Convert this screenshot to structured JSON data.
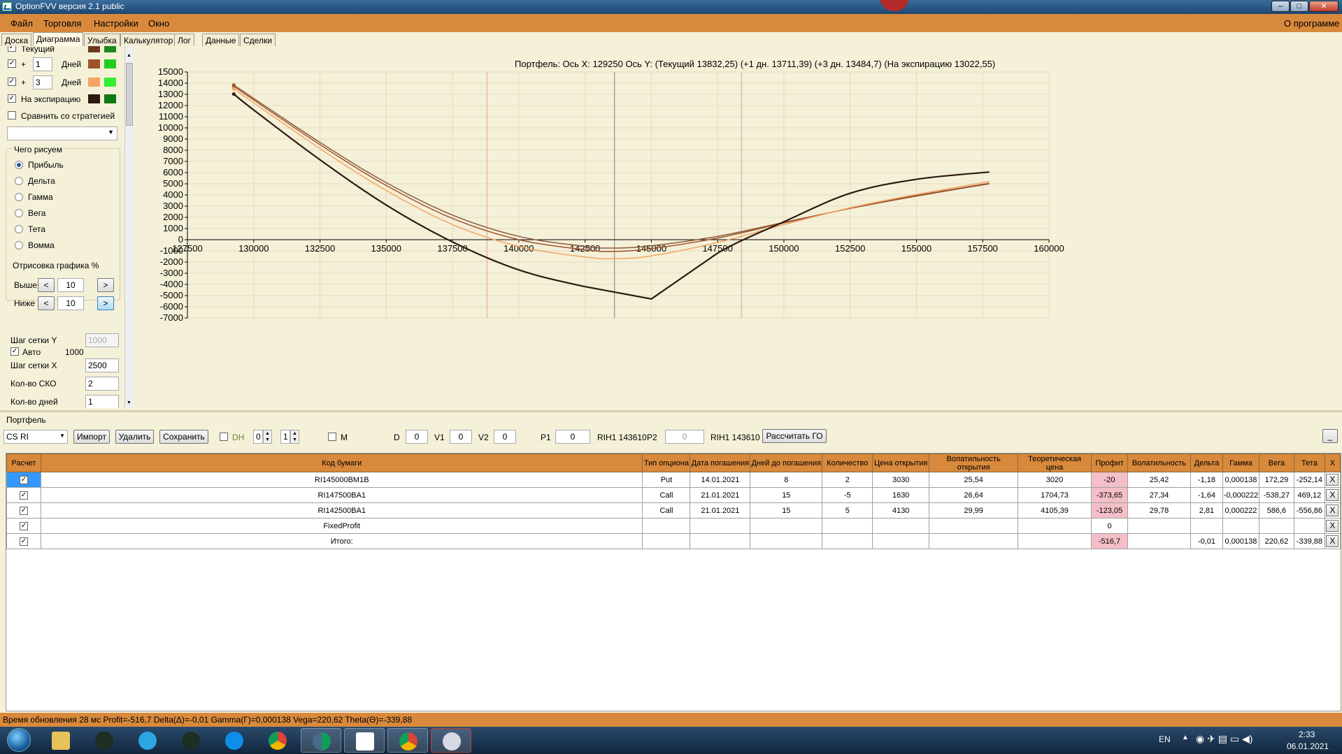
{
  "window": {
    "title": "OptionFVV версия 2.1 public"
  },
  "menu": {
    "items": [
      "Файл",
      "Торговля",
      "Настройки",
      "Окно"
    ],
    "about": "О программе"
  },
  "tabs": [
    "Доска",
    "Диаграмма",
    "Улыбка",
    "Калькулятор",
    "Лог",
    "Данные",
    "Сделки"
  ],
  "left": {
    "curves": [
      {
        "label": "Текущий",
        "plus": "",
        "days": "",
        "days_label": "",
        "color1": "#6b3a1e",
        "color2": "#1a8a1a"
      },
      {
        "label": "",
        "plus": "+",
        "days": "1",
        "days_label": "Дней",
        "color1": "#a0522d",
        "color2": "#22cc22"
      },
      {
        "label": "",
        "plus": "+",
        "days": "3",
        "days_label": "Дней",
        "color1": "#f4a460",
        "color2": "#33ee33"
      },
      {
        "label": "На экспирацию",
        "plus": "",
        "days": "",
        "days_label": "",
        "color1": "#2b1a10",
        "color2": "#0f7a0f"
      }
    ],
    "compare": "Сравнить со стратегией",
    "draw_group": "Чего рисуем",
    "draw_options": [
      "Прибыль",
      "Дельта",
      "Гамма",
      "Вега",
      "Тета",
      "Вомма"
    ],
    "render_group": "Отрисовка графика %",
    "above_label": "Выше",
    "above_value": "10",
    "below_label": "Ниже",
    "below_value": "10",
    "prev": "<",
    "next": ">",
    "grid_y_label": "Шаг сетки Y",
    "grid_y_value": "1000",
    "auto_label": "Авто",
    "auto_value": "1000",
    "grid_x_label": "Шаг сетки X",
    "grid_x_value": "2500",
    "sko_label": "Кол-во СКО",
    "sko_value": "2",
    "days_count_label": "Кол-во дней",
    "days_count_value": "1"
  },
  "chart_data": {
    "type": "line",
    "title": "Портфель: Ось X:  129250 Ось Y:   (Текущий 13832,25)  (+1 дн. 13711,39)  (+3 дн. 13484,7)  (На экспирацию 13022,55)",
    "xlim": [
      127500,
      160000
    ],
    "ylim": [
      -7000,
      15000
    ],
    "x_ticks": [
      127500,
      130000,
      132500,
      135000,
      137500,
      140000,
      142500,
      145000,
      147500,
      150000,
      152500,
      155000,
      157500,
      160000
    ],
    "y_ticks": [
      15000,
      14000,
      13000,
      12000,
      11000,
      10000,
      9000,
      8000,
      7000,
      6000,
      5000,
      4000,
      3000,
      2000,
      1000,
      0,
      -1000,
      -2000,
      -3000,
      -4000,
      -5000,
      -6000,
      -7000
    ],
    "vlines": [
      {
        "x": 143610,
        "color": "#808080"
      },
      {
        "x": 138800,
        "color": "#e8a0a0"
      },
      {
        "x": 148400,
        "color": "#e8a0a0"
      }
    ],
    "series": [
      {
        "color": "#8b5a3c",
        "x": [
          129250,
          132500,
          135000,
          137500,
          140000,
          142500,
          143610,
          145000,
          147500,
          150000,
          152500,
          155000,
          157750
        ],
        "values": [
          13832,
          8700,
          5100,
          2200,
          300,
          -600,
          -750,
          -550,
          300,
          1550,
          2800,
          3900,
          5000
        ]
      },
      {
        "color": "#a0522d",
        "x": [
          129250,
          132500,
          135000,
          137500,
          140000,
          142500,
          143610,
          145000,
          147500,
          150000,
          152500,
          155000,
          157750
        ],
        "values": [
          13711,
          8500,
          4850,
          1900,
          0,
          -900,
          -1050,
          -800,
          150,
          1500,
          2800,
          3950,
          5050
        ]
      },
      {
        "color": "#f4a460",
        "x": [
          129250,
          132500,
          135000,
          137500,
          140000,
          142500,
          143610,
          145000,
          147500,
          150000,
          152500,
          155000,
          157750
        ],
        "values": [
          13485,
          8150,
          4400,
          1350,
          -600,
          -1550,
          -1700,
          -1450,
          -250,
          1350,
          2850,
          4050,
          5200
        ]
      },
      {
        "color": "#2b1a10",
        "x": [
          129250,
          130000,
          132500,
          135000,
          137500,
          140000,
          142500,
          145000,
          147500,
          150000,
          152500,
          155000,
          157750
        ],
        "values": [
          13023,
          11600,
          7150,
          3100,
          -200,
          -2700,
          -4200,
          -5300,
          -1200,
          1600,
          4150,
          5400,
          6050
        ]
      }
    ]
  },
  "portfolio": {
    "title": "Портфель",
    "account": "CS RI",
    "import": "Импорт",
    "delete": "Удалить",
    "save": "Сохранить",
    "dh_label": "DH",
    "dh_v1": "0",
    "dh_v2": "1",
    "m_label": "M",
    "d_label": "D",
    "d_value": "0",
    "v1_label": "V1",
    "v1_value": "0",
    "v2_label": "V2",
    "v2_value": "0",
    "p1_label": "P1",
    "p1_value": "0",
    "rih1": "RIH1 143610",
    "p2_label": "P2",
    "p2_value": "0",
    "rih2": "RIH1 143610",
    "calc_go": "Рассчитать ГО",
    "min_btn": "_",
    "columns": [
      "Расчет",
      "Код бумаги",
      "Тип опциона",
      "Дата погашения",
      "Дней до погашения",
      "Количество",
      "Цена открытия",
      "Волатильность открытия",
      "Теоретическая цена",
      "Профит",
      "Волатильность",
      "Дельта",
      "Гамма",
      "Вега",
      "Тета",
      "X"
    ],
    "rows": [
      [
        "✓",
        "RI145000BM1B",
        "Put",
        "14.01.2021",
        "8",
        "2",
        "3030",
        "25,54",
        "3020",
        "-20",
        "25,42",
        "-1,18",
        "0,000138",
        "172,29",
        "-252,14",
        "X"
      ],
      [
        "✓",
        "RI147500BA1",
        "Call",
        "21.01.2021",
        "15",
        "-5",
        "1630",
        "26,64",
        "1704,73",
        "-373,65",
        "27,34",
        "-1,64",
        "-0,000222",
        "-538,27",
        "469,12",
        "X"
      ],
      [
        "✓",
        "RI142500BA1",
        "Call",
        "21.01.2021",
        "15",
        "5",
        "4130",
        "29,99",
        "4105,39",
        "-123,05",
        "29,78",
        "2,81",
        "0,000222",
        "586,6",
        "-556,86",
        "X"
      ],
      [
        "✓",
        "FixedProfit",
        "",
        "",
        "",
        "",
        "",
        "",
        "",
        "0",
        "",
        "",
        "",
        "",
        "",
        "X"
      ],
      [
        "✓",
        "Итого:",
        "",
        "",
        "",
        "",
        "",
        "",
        "",
        "-516,7",
        "",
        "-0,01",
        "0,000138",
        "220,62",
        "-339,88",
        "X"
      ]
    ]
  },
  "status": "Время обновления 28 мс  Profit=-516,7 Delta(Δ)=-0,01 Gamma(Г)=0,000138 Vega=220,62 Theta(Θ)=-339,88",
  "taskbar": {
    "lang": "EN",
    "time": "2:33",
    "date": "06.01.2021"
  }
}
